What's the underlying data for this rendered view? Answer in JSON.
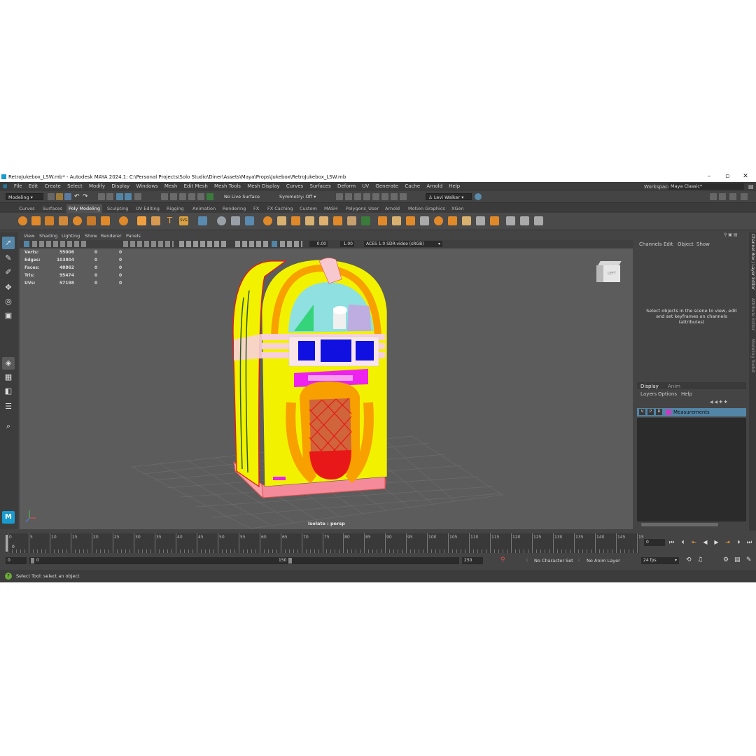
{
  "window": {
    "title": "RetroJukebox_LSW.mb* - Autodesk MAYA 2024.1: C:\\Personal Projects\\Solo Studio\\Diner\\Assets\\Maya\\Props\\Jukebox\\RetroJukebox_LSW.mb"
  },
  "menubar": {
    "items": [
      "File",
      "Edit",
      "Create",
      "Select",
      "Modify",
      "Display",
      "Windows",
      "Mesh",
      "Edit Mesh",
      "Mesh Tools",
      "Mesh Display",
      "Curves",
      "Surfaces",
      "Deform",
      "UV",
      "Generate",
      "Cache",
      "Arnold",
      "Help"
    ],
    "workspace_label": "Workspace:",
    "workspace_value": "Maya Classic*"
  },
  "statusline": {
    "mode": "Modeling",
    "live_surface": "No Live Surface",
    "symmetry": "Symmetry: Off",
    "user": "Levi Walker"
  },
  "shelf": {
    "tabs": [
      "Curves",
      "Surfaces",
      "Poly Modeling",
      "Sculpting",
      "UV Editing",
      "Rigging",
      "Animation",
      "Rendering",
      "FX",
      "FX Caching",
      "Custom",
      "MASH",
      "Polygons_User",
      "Arnold",
      "Motion Graphics",
      "XGen"
    ],
    "active_tab": "Poly Modeling"
  },
  "viewport": {
    "menu": [
      "View",
      "Shading",
      "Lighting",
      "Show",
      "Renderer",
      "Panels"
    ],
    "exposure": "0.00",
    "gamma": "1.00",
    "color_space": "ACES 1.0 SDR-video (sRGB)",
    "camera_label": "Isolate : persp",
    "viewcube_label": "LEFT",
    "hud": {
      "rows": [
        {
          "label": "Verts:",
          "v1": "55006",
          "v2": "0",
          "v3": "0"
        },
        {
          "label": "Edges:",
          "v1": "103804",
          "v2": "0",
          "v3": "0"
        },
        {
          "label": "Faces:",
          "v1": "48862",
          "v2": "0",
          "v3": "0"
        },
        {
          "label": "Tris:",
          "v1": "95474",
          "v2": "0",
          "v3": "0"
        },
        {
          "label": "UVs:",
          "v1": "57198",
          "v2": "0",
          "v3": "0"
        }
      ]
    }
  },
  "channelbox": {
    "menu": [
      "Channels",
      "Edit",
      "Object",
      "Show"
    ],
    "message": "Select objects in the scene to view, edit and set keyframes on channels (attributes)"
  },
  "layereditor": {
    "tabs": [
      "Display",
      "Anim"
    ],
    "menu": [
      "Layers",
      "Options",
      "Help"
    ],
    "layer": {
      "v": "V",
      "p": "P",
      "r": "R",
      "name": "Measurements",
      "color": "#c83cc0"
    }
  },
  "sidebar": {
    "tabs": [
      "Channel Box / Layer Editor",
      "Attribute Editor",
      "Modeling Toolkit"
    ]
  },
  "timeslider": {
    "ticks": [
      "0",
      "5",
      "10",
      "15",
      "20",
      "25",
      "30",
      "35",
      "40",
      "45",
      "50",
      "55",
      "60",
      "65",
      "70",
      "75",
      "80",
      "85",
      "90",
      "95",
      "100",
      "105",
      "110",
      "115",
      "120",
      "125",
      "130",
      "135",
      "140",
      "145",
      "15"
    ],
    "current_frame": "0",
    "frame_marker": "0"
  },
  "rangeslider": {
    "start": "0",
    "inner_start": "0",
    "inner_end": "150",
    "end": "250",
    "character_set": "No Character Set",
    "anim_layer": "No Anim Layer",
    "fps": "24 fps"
  },
  "helpline": {
    "text": "Select Tool: select an object"
  },
  "colors": {
    "accent": "#5285a6",
    "jukebox_yellow": "#f2f200",
    "jukebox_orange": "#f7a000",
    "jukebox_red": "#e81818",
    "jukebox_pink": "#f58a9a",
    "jukebox_blue": "#1010e0",
    "jukebox_magenta": "#ee22ee"
  }
}
